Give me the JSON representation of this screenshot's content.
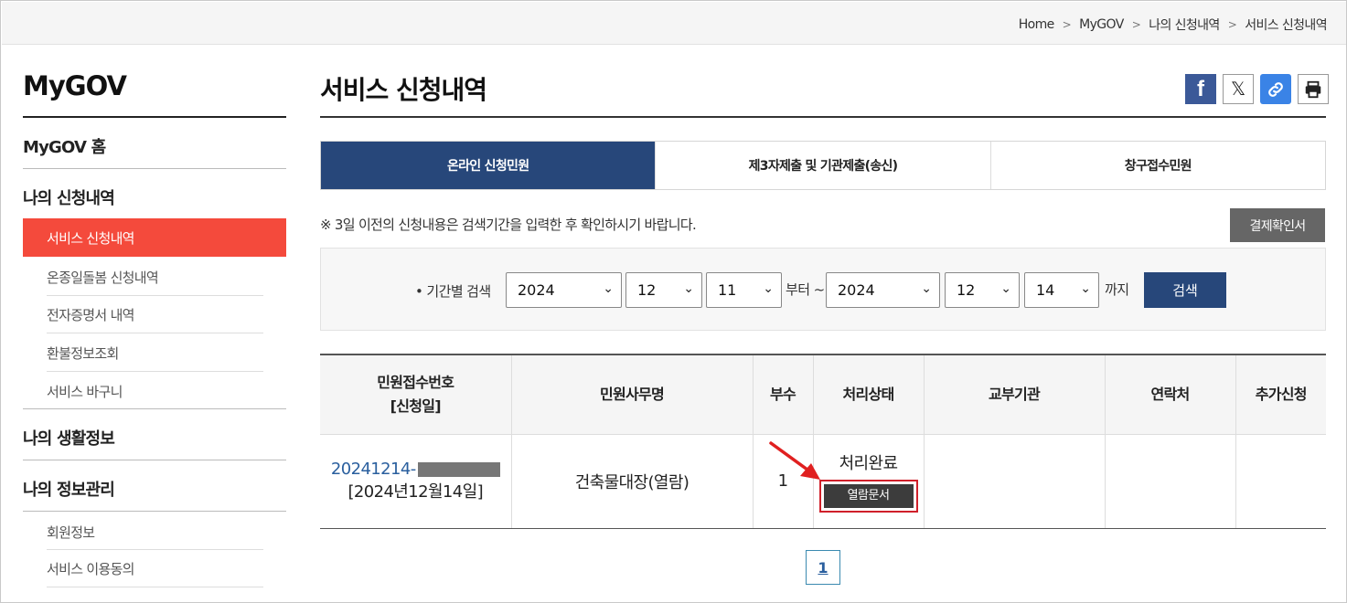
{
  "breadcrumb": [
    "Home",
    "MyGOV",
    "나의 신청내역",
    "서비스 신청내역"
  ],
  "sidebar": {
    "title": "MyGOV",
    "home": "MyGOV 홈",
    "section1": "나의 신청내역",
    "active": "서비스 신청내역",
    "sub1": [
      "온종일돌봄 신청내역",
      "전자증명서 내역",
      "환불정보조회",
      "서비스 바구니"
    ],
    "section2": "나의 생활정보",
    "section3": "나의 정보관리",
    "sub3": [
      "회원정보",
      "서비스 이용동의"
    ]
  },
  "page": {
    "title": "서비스 신청내역",
    "share_icons": [
      "facebook-icon",
      "x-icon",
      "link-icon",
      "print-icon"
    ]
  },
  "tabs": [
    "온라인 신청민원",
    "제3자제출 및 기관제출(송신)",
    "창구접수민원"
  ],
  "notice": "※ 3일 이전의 신청내용은 검색기간을 입력한 후 확인하시기 바랍니다.",
  "confirm_button": "결제확인서",
  "search": {
    "label": "• 기간별 검색",
    "from_year": "2024",
    "from_month": "12",
    "from_day": "11",
    "from_text": "부터 ~",
    "to_year": "2024",
    "to_month": "12",
    "to_day": "14",
    "to_text": "까지",
    "button": "검색"
  },
  "table": {
    "headers": [
      "민원접수번호\n[신청일]",
      "민원사무명",
      "부수",
      "처리상태",
      "교부기관",
      "연락처",
      "추가신청"
    ],
    "header_col0_line1": "민원접수번호",
    "header_col0_line2": "[신청일]",
    "row": {
      "receipt_no": "20241214-",
      "date": "[2024년12월14일]",
      "service": "건축물대장(열람)",
      "copies": "1",
      "status": "처리완료",
      "view_button": "열람문서",
      "agency": "",
      "contact": "",
      "extra": ""
    }
  },
  "pagination": {
    "current": "1"
  },
  "colors": {
    "accent_red": "#f44a3c",
    "navy": "#27477a",
    "highlight_red": "#d0202a"
  }
}
